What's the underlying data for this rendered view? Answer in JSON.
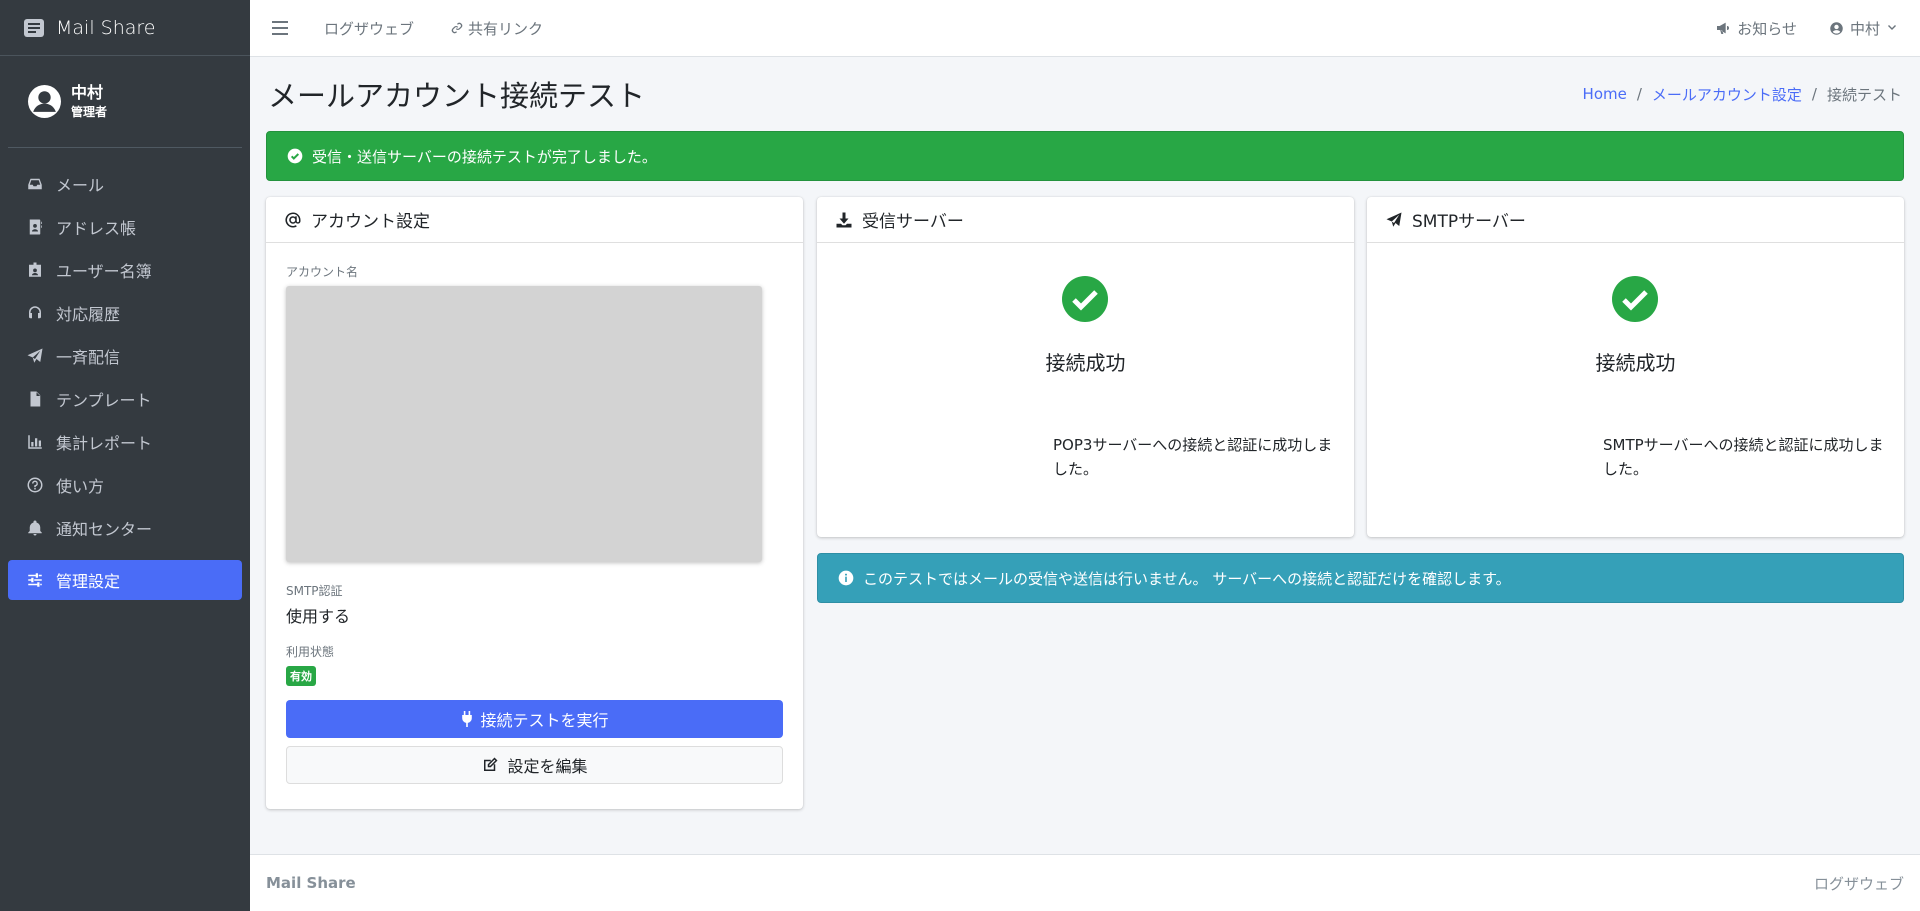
{
  "app": {
    "brand": "Mail Share"
  },
  "user": {
    "name": "中村",
    "role": "管理者"
  },
  "sidebar": {
    "items": [
      {
        "label": "メール",
        "icon": "inbox-icon"
      },
      {
        "label": "アドレス帳",
        "icon": "address-book-icon"
      },
      {
        "label": "ユーザー名簿",
        "icon": "id-badge-icon"
      },
      {
        "label": "対応履歴",
        "icon": "headset-icon"
      },
      {
        "label": "一斉配信",
        "icon": "paper-plane-icon"
      },
      {
        "label": "テンプレート",
        "icon": "file-icon"
      },
      {
        "label": "集計レポート",
        "icon": "bar-chart-icon"
      },
      {
        "label": "使い方",
        "icon": "question-circle-icon"
      },
      {
        "label": "通知センター",
        "icon": "bell-icon"
      },
      {
        "label": "管理設定",
        "icon": "sliders-icon",
        "active": true
      }
    ]
  },
  "topbar": {
    "links": [
      {
        "label": "ログザウェブ"
      },
      {
        "label": "共有リンク",
        "icon": "link-icon"
      }
    ],
    "notifications_label": "お知らせ",
    "user_menu_label": "中村"
  },
  "page": {
    "title": "メールアカウント接続テスト",
    "breadcrumb": [
      "Home",
      "メールアカウント設定",
      "接続テスト"
    ],
    "success_message": "受信・送信サーバーの接続テストが完了しました。",
    "info_message": "このテストではメールの受信や送信は行いません。 サーバーへの接続と認証だけを確認します。"
  },
  "account": {
    "header": "アカウント設定",
    "name_label": "アカウント名",
    "smtp_auth_label": "SMTP認証",
    "smtp_auth_value": "使用する",
    "status_label": "利用状態",
    "status_badge": "有効",
    "run_button": "接続テストを実行",
    "edit_button": "設定を編集"
  },
  "servers": [
    {
      "header": "受信サーバー",
      "icon": "download-icon",
      "status": "接続成功",
      "description": "POP3サーバーへの接続と認証に成功しました。"
    },
    {
      "header": "SMTPサーバー",
      "icon": "paper-plane-icon",
      "status": "接続成功",
      "description": "SMTPサーバーへの接続と認証に成功しました。"
    }
  ],
  "footer": {
    "brand": "Mail Share",
    "right": "ログザウェブ"
  },
  "colors": {
    "primary": "#4a6cf7",
    "success": "#28a745",
    "info": "#35a0b8",
    "sidebar": "#343a40"
  }
}
